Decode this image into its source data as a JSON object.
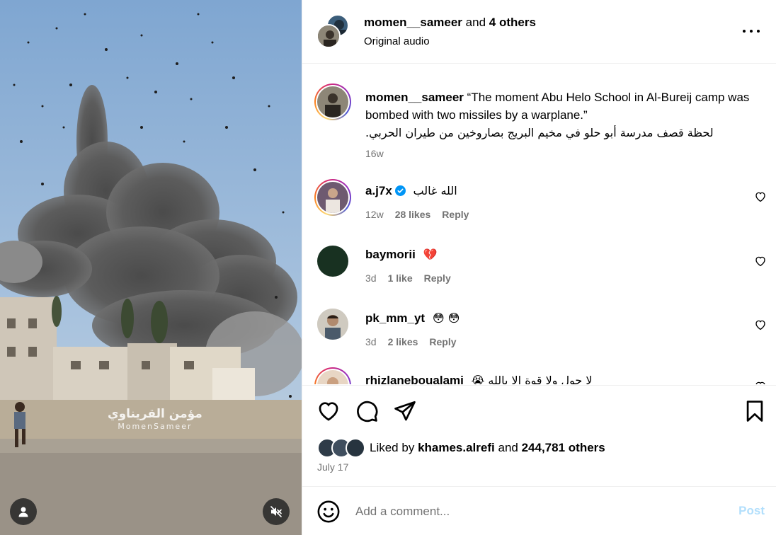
{
  "media": {
    "watermark_arabic": "مؤمن القريناوي",
    "watermark_latin": "MomenSameer",
    "user_icon": "user-icon",
    "mute_icon": "speaker-muted-icon"
  },
  "header": {
    "username": "momen__sameer",
    "and_text": "and",
    "others": "4 others",
    "audio": "Original audio",
    "more_icon": "more-horizontal-icon"
  },
  "caption": {
    "username": "momen__sameer",
    "text_en": "“The moment Abu Helo School in Al-Bureij camp was bombed with two missiles by a warplane.”",
    "text_ar": "لحظة قصف مدرسة أبو حلو في مخيم البريج بصاروخين من طيران الحربي.",
    "time": "16w"
  },
  "comments": [
    {
      "username": "a.j7x",
      "verified": true,
      "text": "الله غالب",
      "time": "12w",
      "likes": "28 likes",
      "reply": "Reply"
    },
    {
      "username": "baymorii",
      "verified": false,
      "text": "💔",
      "time": "3d",
      "likes": "1 like",
      "reply": "Reply"
    },
    {
      "username": "pk_mm_yt",
      "verified": false,
      "text": "😳 😳",
      "time": "3d",
      "likes": "2 likes",
      "reply": "Reply"
    },
    {
      "username": "rhizlaneboualami",
      "verified": false,
      "text": "😭 لا حول ولا قوة الا بالله",
      "time": "",
      "likes": "",
      "reply": ""
    }
  ],
  "actions": {
    "like_icon": "heart-icon",
    "comment_icon": "comment-icon",
    "share_icon": "send-icon",
    "save_icon": "bookmark-icon",
    "liked_by_prefix": "Liked by",
    "liked_by_user": "khames.alrefi",
    "liked_by_and": "and",
    "liked_by_count": "244,781 others",
    "date": "July 17"
  },
  "add_comment": {
    "placeholder": "Add a comment...",
    "post_label": "Post",
    "emoji_icon": "smiley-icon"
  },
  "colors": {
    "verified_blue": "#0095f6",
    "post_disabled": "#b2dffc",
    "meta_gray": "#737373",
    "divider": "#efefef"
  }
}
